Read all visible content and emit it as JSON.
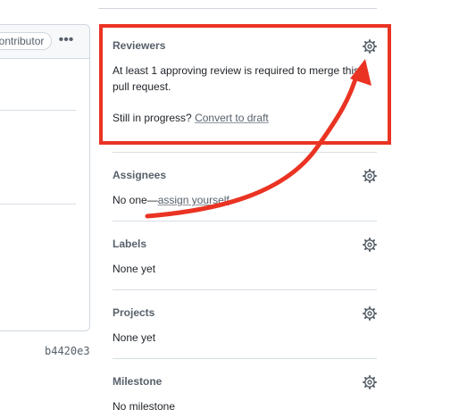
{
  "left_card": {
    "badge_text": "Contributor",
    "kebab_label": "•••",
    "commit_sha": "b4420e3"
  },
  "sidebar": {
    "reviewers": {
      "title": "Reviewers",
      "message": "At least 1 approving review is required to merge this pull request.",
      "draft_prompt": "Still in progress?",
      "draft_link": "Convert to draft"
    },
    "assignees": {
      "title": "Assignees",
      "value_prefix": "No one—",
      "assign_link": "assign yourself"
    },
    "labels": {
      "title": "Labels",
      "value": "None yet"
    },
    "projects": {
      "title": "Projects",
      "value": "None yet"
    },
    "milestone": {
      "title": "Milestone",
      "value": "No milestone"
    }
  },
  "annotation": {
    "color": "#ea3323",
    "icon": "gear-icon"
  }
}
